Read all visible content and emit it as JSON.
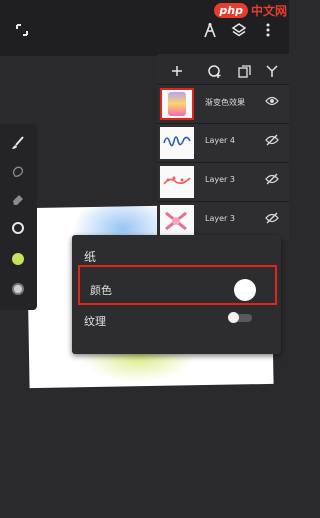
{
  "topbar": {
    "icons": [
      "collapse-icon",
      "compass-icon",
      "layers-icon",
      "more-vert-icon"
    ]
  },
  "watermark": {
    "logo": "php",
    "text": "中文网"
  },
  "left_toolbar": {
    "tools": [
      "brush-icon",
      "smudge-icon",
      "eraser-icon",
      "size-ring-icon",
      "color-dot-icon",
      "opacity-icon"
    ],
    "accent_color": "#c7e35a"
  },
  "layers_panel": {
    "toolbar": [
      "add-layer-icon",
      "add-layer-from-icon",
      "duplicate-icon",
      "merge-icon"
    ],
    "layers": [
      {
        "name": "渐变色效果",
        "visible": true,
        "selected": true
      },
      {
        "name": "Layer 4",
        "visible": false,
        "selected": false
      },
      {
        "name": "Layer 3",
        "visible": false,
        "selected": false
      },
      {
        "name": "Layer 3",
        "visible": false,
        "selected": false
      }
    ]
  },
  "paper_popup": {
    "title": "纸",
    "color_label": "颜色",
    "color_value": "#ffffff",
    "texture_label": "纹理",
    "texture_on": false,
    "highlight_color": "#e0261b"
  }
}
